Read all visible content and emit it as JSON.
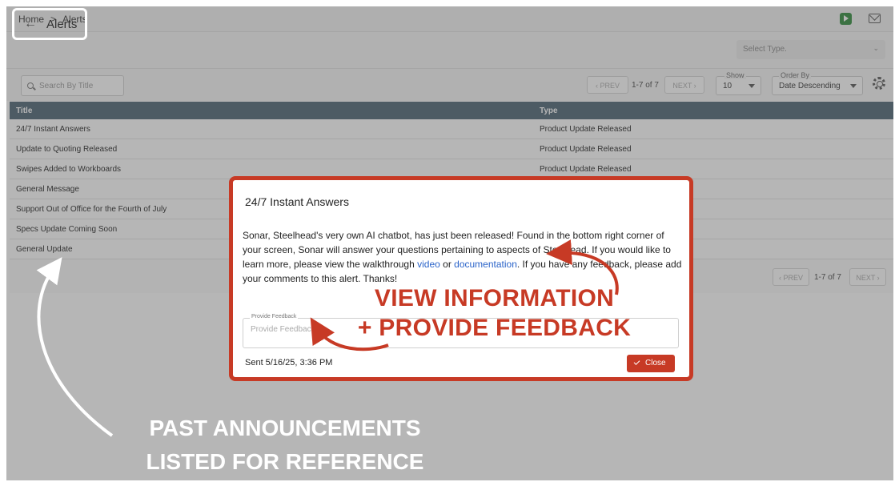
{
  "topbar": {
    "breadcrumb": [
      "Home",
      ">",
      "Alerts"
    ],
    "icons": [
      "play-icon",
      "mail-icon"
    ]
  },
  "header": {
    "back_label": "Alerts",
    "select_type_placeholder": "Select Type."
  },
  "toolbar": {
    "search_placeholder": "Search By Title",
    "prev_label": "‹ PREV",
    "count": "1-7 of 7",
    "next_label": "NEXT ›",
    "show_label": "Show",
    "show_value": "10",
    "order_label": "Order By",
    "order_value": "Date Descending"
  },
  "table": {
    "columns": [
      "Title",
      "Type"
    ],
    "rows": [
      {
        "title": "24/7 Instant Answers",
        "type": "Product Update Released"
      },
      {
        "title": "Update to Quoting Released",
        "type": "Product Update Released"
      },
      {
        "title": "Swipes Added to Workboards",
        "type": "Product Update Released"
      },
      {
        "title": "General Message",
        "type": ""
      },
      {
        "title": "Support Out of Office for the Fourth of July",
        "type": ""
      },
      {
        "title": "Specs Update Coming Soon",
        "type": ""
      },
      {
        "title": "General Update",
        "type": ""
      }
    ],
    "footer_prev": "‹ PREV",
    "footer_count": "1-7 of 7",
    "footer_next": "NEXT ›"
  },
  "modal": {
    "title": "24/7 Instant Answers",
    "body_1": "Sonar, Steelhead's very own AI chatbot, has just been released! Found in the bottom right corner of your screen, Sonar will answer your questions pertaining to aspects of Steelhead. If you would like to learn more, please view the walkthrough ",
    "link_video": "video",
    "body_2": " or ",
    "link_docs": "documentation",
    "body_3": ". If you have any feedback, please add your comments to this alert. Thanks!",
    "feedback_label": "Provide Feedback",
    "feedback_placeholder": "Provide Feedback...",
    "sent": "Sent 5/16/25, 3:36 PM",
    "close_label": "Close"
  },
  "callouts": {
    "modal_line1": "VIEW INFORMATION",
    "modal_line2": "+ PROVIDE FEEDBACK",
    "past_line1": "PAST ANNOUNCEMENTS",
    "past_line2": "LISTED FOR REFERENCE"
  },
  "colors": {
    "accent": "#c73a25",
    "table_header": "#4a6272",
    "link": "#2a63c9"
  }
}
